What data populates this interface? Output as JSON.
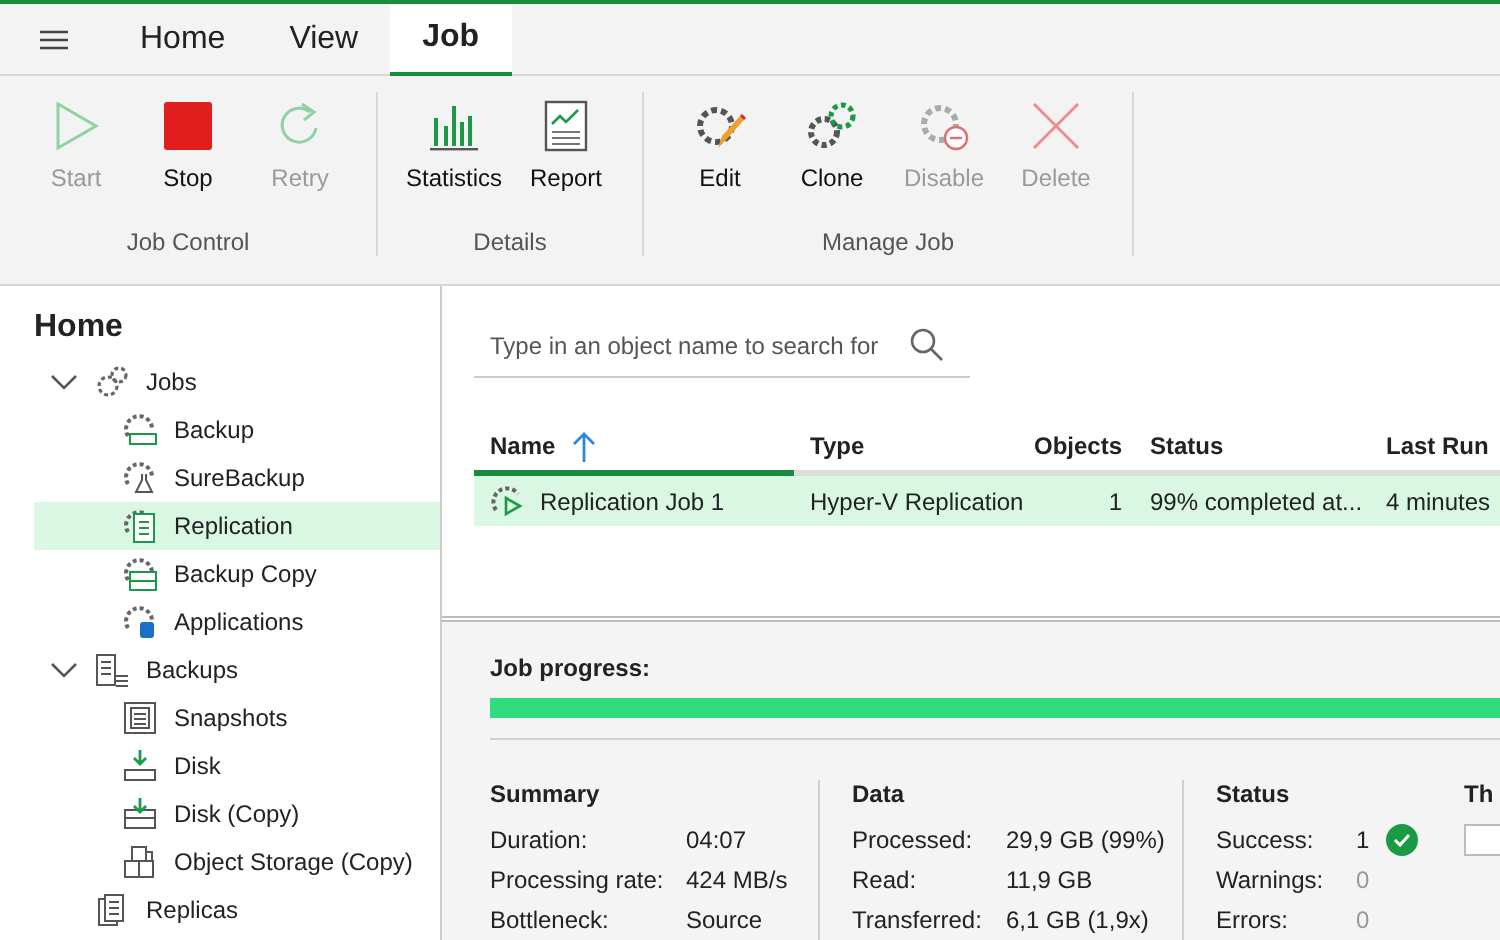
{
  "menu_tabs": [
    {
      "label": "Home",
      "selected": false
    },
    {
      "label": "View",
      "selected": false
    },
    {
      "label": "Job",
      "selected": true
    }
  ],
  "ribbon": [
    {
      "label": "Job Control",
      "buttons": [
        {
          "label": "Start",
          "kind": "start",
          "disabled": true
        },
        {
          "label": "Stop",
          "kind": "stop",
          "disabled": false
        },
        {
          "label": "Retry",
          "kind": "retry",
          "disabled": true
        }
      ]
    },
    {
      "label": "Details",
      "buttons": [
        {
          "label": "Statistics",
          "kind": "statistics",
          "disabled": false
        },
        {
          "label": "Report",
          "kind": "report",
          "disabled": false
        }
      ]
    },
    {
      "label": "Manage Job",
      "buttons": [
        {
          "label": "Edit",
          "kind": "edit",
          "disabled": false
        },
        {
          "label": "Clone",
          "kind": "clone",
          "disabled": false
        },
        {
          "label": "Disable",
          "kind": "disable",
          "disabled": true
        },
        {
          "label": "Delete",
          "kind": "delete",
          "disabled": true
        }
      ]
    }
  ],
  "sidebar": {
    "title": "Home",
    "items": [
      {
        "label": "Jobs",
        "kind": "jobs",
        "expanded": true,
        "selected": false,
        "children": [
          {
            "label": "Backup",
            "kind": "backup",
            "selected": false
          },
          {
            "label": "SureBackup",
            "kind": "surebackup",
            "selected": false
          },
          {
            "label": "Replication",
            "kind": "replication",
            "selected": true
          },
          {
            "label": "Backup Copy",
            "kind": "backupcopy",
            "selected": false
          },
          {
            "label": "Applications",
            "kind": "applications",
            "selected": false
          }
        ]
      },
      {
        "label": "Backups",
        "kind": "backups",
        "expanded": true,
        "selected": false,
        "children": [
          {
            "label": "Snapshots",
            "kind": "snapshots",
            "selected": false
          },
          {
            "label": "Disk",
            "kind": "disk",
            "selected": false
          },
          {
            "label": "Disk (Copy)",
            "kind": "diskcopy",
            "selected": false
          },
          {
            "label": "Object Storage (Copy)",
            "kind": "objectstorage",
            "selected": false
          }
        ]
      },
      {
        "label": "Replicas",
        "kind": "replicas",
        "selected": false
      }
    ]
  },
  "search": {
    "placeholder": "Type in an object name to search for"
  },
  "table": {
    "columns": [
      {
        "label": "Name",
        "sorted": true
      },
      {
        "label": "Type",
        "sorted": false
      },
      {
        "label": "Objects",
        "sorted": false
      },
      {
        "label": "Status",
        "sorted": false
      },
      {
        "label": "Last Run",
        "sorted": false
      }
    ],
    "rows": [
      {
        "selected": true,
        "cells": [
          "Replication Job 1",
          "Hyper-V Replication",
          "1",
          "99% completed at...",
          "4 minutes"
        ]
      }
    ]
  },
  "job_progress": {
    "label": "Job progress:",
    "level": 1.0
  },
  "sections": [
    {
      "title": "Summary",
      "rows": [
        {
          "label": "Duration:",
          "value": "04:07"
        },
        {
          "label": "Processing rate:",
          "value": "424 MB/s"
        },
        {
          "label": "Bottleneck:",
          "value": "Source"
        }
      ]
    },
    {
      "title": "Data",
      "rows": [
        {
          "label": "Processed:",
          "value": "29,9 GB (99%)"
        },
        {
          "label": "Read:",
          "value": "11,9 GB"
        },
        {
          "label": "Transferred:",
          "value": "6,1 GB (1,9x)"
        }
      ]
    },
    {
      "title": "Status",
      "rows": [
        {
          "label": "Success:",
          "value": "1",
          "dimmed": false,
          "check": true
        },
        {
          "label": "Warnings:",
          "value": "0",
          "dimmed": true,
          "check": false
        },
        {
          "label": "Errors:",
          "value": "0",
          "dimmed": true,
          "check": false
        }
      ]
    }
  ],
  "column_4_heading": "Th"
}
